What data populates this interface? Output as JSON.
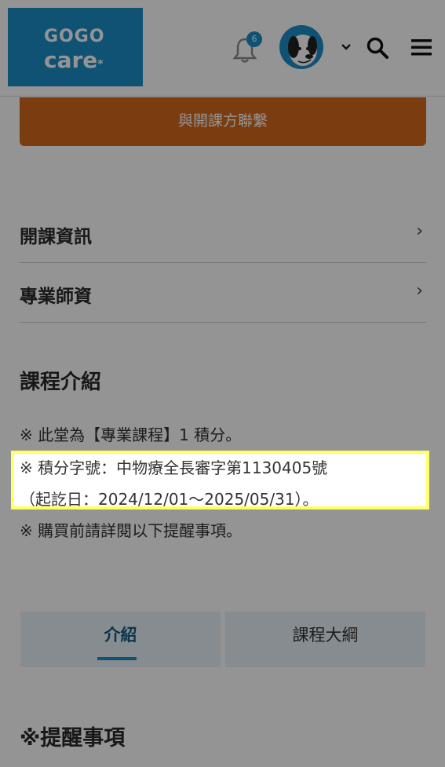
{
  "header": {
    "logo_line1": "GOGO",
    "logo_line2": "care",
    "logo_mark": "*",
    "notification_count": "6",
    "icons": [
      "bell-icon",
      "avatar",
      "chevron-down-icon",
      "search-icon",
      "menu-icon"
    ]
  },
  "contact_button": "與開課方聯繫",
  "accordion": [
    {
      "label": "開課資訊",
      "arrow": "›"
    },
    {
      "label": "專業師資",
      "arrow": "›"
    }
  ],
  "intro": {
    "title": "課程介紹",
    "note1": "※ 此堂為【專業課程】1 積分。",
    "note2_line1": "※ 積分字號：中物療全長審字第1130405號",
    "note2_line2": "（起訖日：2024/12/01～2025/05/31）。",
    "note3": "※ 購買前請詳閱以下提醒事項。"
  },
  "tabs": [
    {
      "label": "介紹",
      "active": true
    },
    {
      "label": "課程大綱",
      "active": false
    }
  ],
  "reminder_title": "※提醒事項",
  "colors": {
    "brand": "#1a8dc9",
    "button": "#d5681b",
    "highlight": "#ffff66"
  }
}
